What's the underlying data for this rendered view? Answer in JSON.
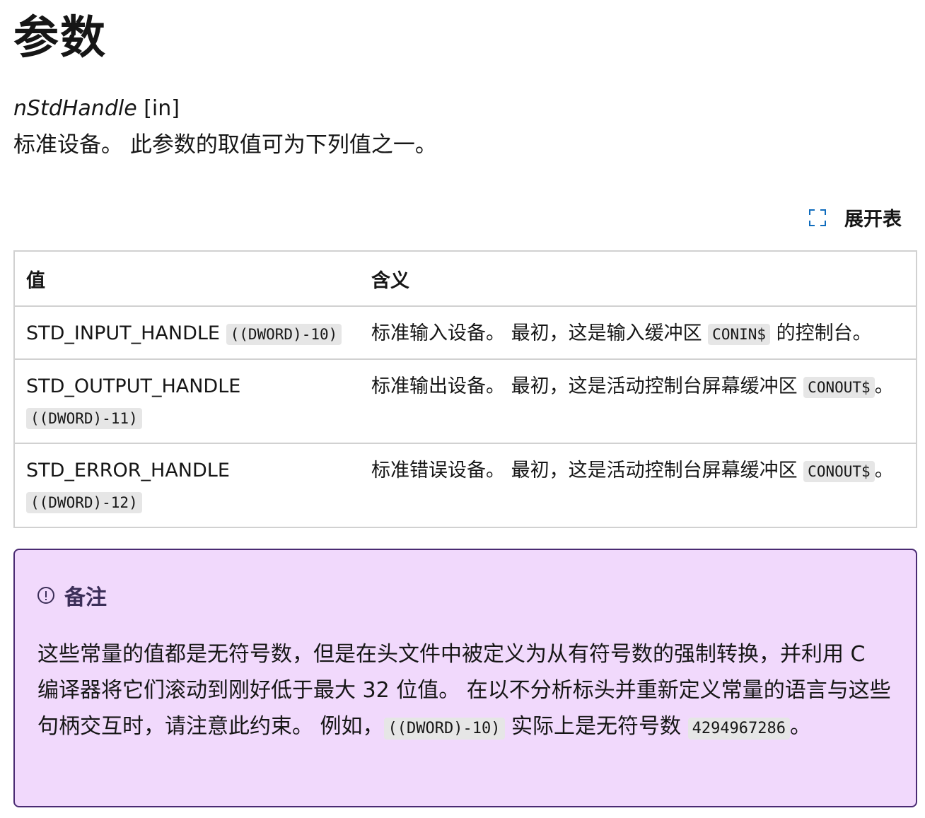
{
  "heading": "参数",
  "param": {
    "name": "nStdHandle",
    "direction": "[in]",
    "description": "标准设备。 此参数的取值可为下列值之一。"
  },
  "expand_label": "展开表",
  "table": {
    "headers": [
      "值",
      "含义"
    ],
    "rows": [
      {
        "name": "STD_INPUT_HANDLE",
        "code": "((DWORD)-10)",
        "meaning_pre": "标准输入设备。 最初，这是输入缓冲区 ",
        "meaning_code": "CONIN$",
        "meaning_post": " 的控制台。"
      },
      {
        "name": "STD_OUTPUT_HANDLE",
        "code": "((DWORD)-11)",
        "meaning_pre": "标准输出设备。 最初，这是活动控制台屏幕缓冲区 ",
        "meaning_code": "CONOUT$",
        "meaning_post": "。"
      },
      {
        "name": "STD_ERROR_HANDLE",
        "code": "((DWORD)-12)",
        "meaning_pre": "标准错误设备。 最初，这是活动控制台屏幕缓冲区 ",
        "meaning_code": "CONOUT$",
        "meaning_post": "。"
      }
    ]
  },
  "note": {
    "title": "备注",
    "text_1": "这些常量的值都是无符号数，但是在头文件中被定义为从有符号数的强制转换，并利用 C 编译器将它们滚动到刚好低于最大 32 位值。 在以不分析标头并重新定义常量的语言与这些句柄交互时，请注意此约束。 例如，",
    "code_1": "((DWORD)-10)",
    "text_2": " 实际上是无符号数 ",
    "code_2": "4294967286",
    "text_3": "。"
  }
}
